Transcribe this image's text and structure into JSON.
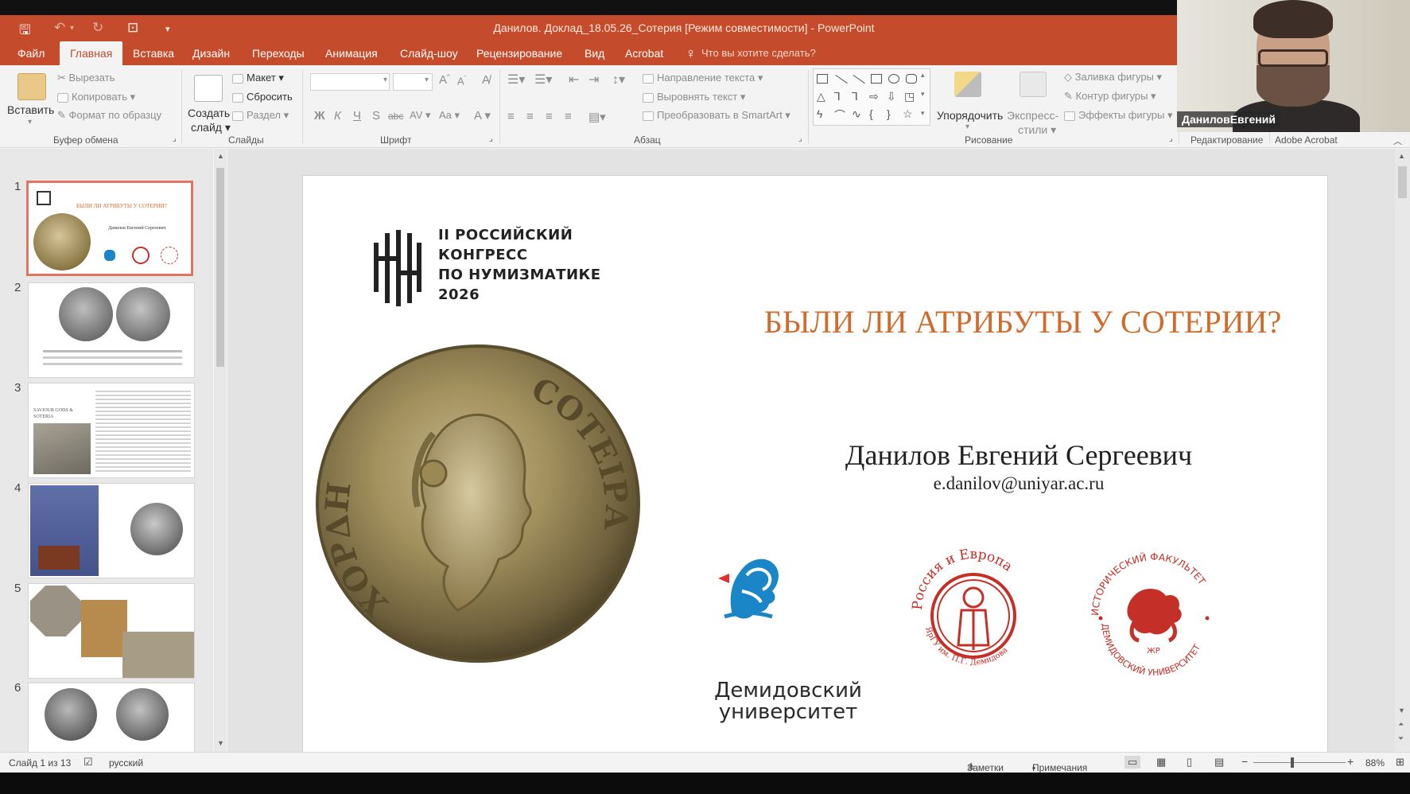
{
  "title_bar": {
    "document_title": "Данилов. Доклад_18.05.26_Сотерия [Режим совместимости] - PowerPoint"
  },
  "menu": {
    "tabs": [
      "Файл",
      "Главная",
      "Вставка",
      "Дизайн",
      "Переходы",
      "Анимация",
      "Слайд-шоу",
      "Рецензирование",
      "Вид",
      "Acrobat"
    ],
    "tell_me": "Что вы хотите сделать?"
  },
  "ribbon": {
    "clipboard": {
      "paste": "Вставить",
      "cut": "Вырезать",
      "copy": "Копировать",
      "format_painter": "Формат по образцу",
      "group": "Буфер обмена"
    },
    "slides": {
      "new_slide_1": "Создать",
      "new_slide_2": "слайд",
      "layout": "Макет",
      "reset": "Сбросить",
      "section": "Раздел",
      "group": "Слайды"
    },
    "font": {
      "bold": "Ж",
      "italic": "К",
      "underline": "Ч",
      "shadow": "S",
      "strike": "abc",
      "spacing": "AV",
      "case": "Aa",
      "color": "A",
      "group": "Шрифт"
    },
    "paragraph": {
      "text_direction": "Направление текста",
      "align_text": "Выровнять текст",
      "smartart": "Преобразовать в SmartArt",
      "group": "Абзац"
    },
    "drawing": {
      "arrange": "Упорядочить",
      "quick_styles_1": "Экспресс-",
      "quick_styles_2": "стили",
      "shape_fill": "Заливка фигуры",
      "shape_outline": "Контур фигуры",
      "shape_effects": "Эффекты фигуры",
      "group": "Рисование"
    },
    "editing": {
      "group": "Редактирование"
    },
    "acrobat": {
      "group": "Adobe Acrobat"
    }
  },
  "webcam": {
    "name": "ДаниловЕвгений"
  },
  "thumbnails": {
    "numbers": [
      "1",
      "2",
      "3",
      "4",
      "5",
      "6"
    ],
    "slide1_title": "БЫЛИ ЛИ АТРИБУТЫ У СОТЕРИИ?",
    "slide1_author": "Данилов Евгений Сергеевич",
    "slide3_title": "SAVIOUR GODS & SOTERIA"
  },
  "slide": {
    "congress_lines": [
      "II РОССИЙСКИЙ",
      "КОНГРЕСС",
      "ПО НУМИЗМАТИКЕ",
      "2026"
    ],
    "title": "БЫЛИ ЛИ АТРИБУТЫ У СОТЕРИИ?",
    "author": "Данилов Евгений Сергеевич",
    "email": "e.danilov@uniyar.ac.ru",
    "coin_legend_left": "ΧΟΡΔΗ",
    "coin_legend_right": "COTΕΙΡΑ",
    "university_line1": "Демидовский",
    "university_line2": "университет",
    "seal1_top": "Россия и Европа",
    "seal1_bottom": "ЯрГУ им. П.Г. Демидова",
    "seal2_top": "ИСТОРИЧЕСКИЙ ФАКУЛЬТЕТ",
    "seal2_bottom": "ДЕМИДОВСКИЙ УНИВЕРСИТЕТ",
    "seal2_mark": "ЖР"
  },
  "status_bar": {
    "slide_info": "Слайд 1 из 13",
    "language": "русский",
    "notes": "Заметки",
    "comments": "Примечания",
    "zoom": "88%",
    "zoom_minus": "−",
    "zoom_plus": "+"
  },
  "colors": {
    "accent": "#c44b2b",
    "slide_title": "#d06b2b",
    "selection": "#e0765f",
    "logo_blue": "#1a86c8",
    "seal_red": "#c42f27"
  }
}
